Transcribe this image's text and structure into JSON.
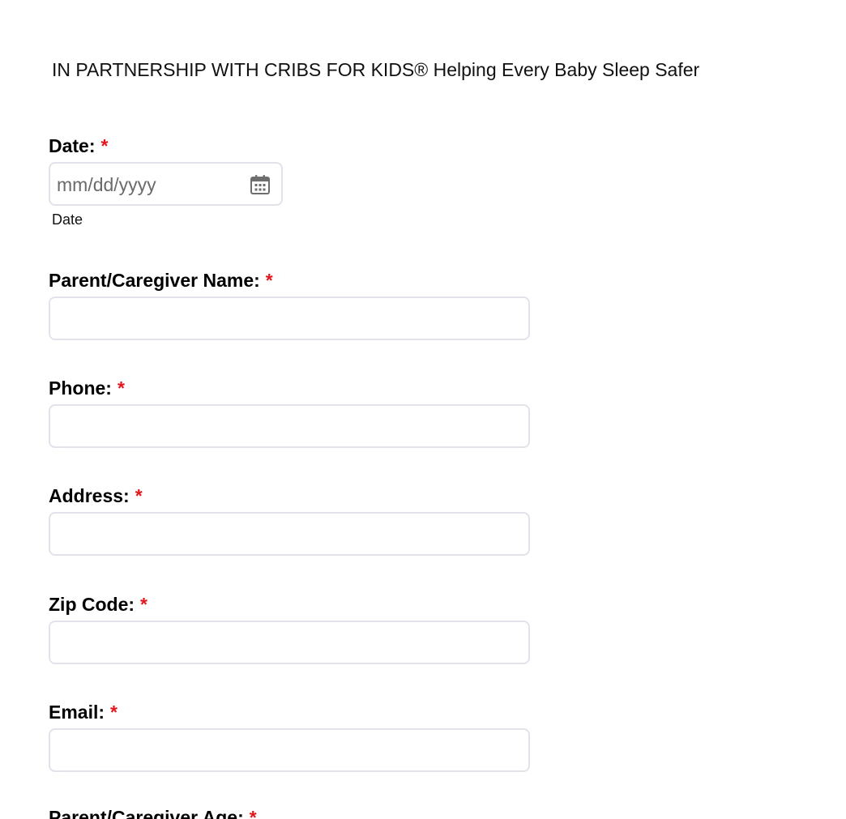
{
  "header": {
    "text": "IN PARTNERSHIP WITH CRIBS FOR KIDS® Helping Every Baby Sleep Safer"
  },
  "form": {
    "required_marker": "*",
    "required_color": "#e4161b",
    "date": {
      "label": "Date:",
      "placeholder": "mm/dd/yyyy",
      "sublabel": "Date",
      "icon": "calendar-icon"
    },
    "parent_name": {
      "label": "Parent/Caregiver Name:",
      "value": ""
    },
    "phone": {
      "label": "Phone:",
      "value": ""
    },
    "address": {
      "label": "Address:",
      "value": ""
    },
    "zip": {
      "label": "Zip Code:",
      "value": ""
    },
    "email": {
      "label": "Email:",
      "value": ""
    },
    "parent_age": {
      "label": "Parent/Caregiver Age:"
    }
  }
}
